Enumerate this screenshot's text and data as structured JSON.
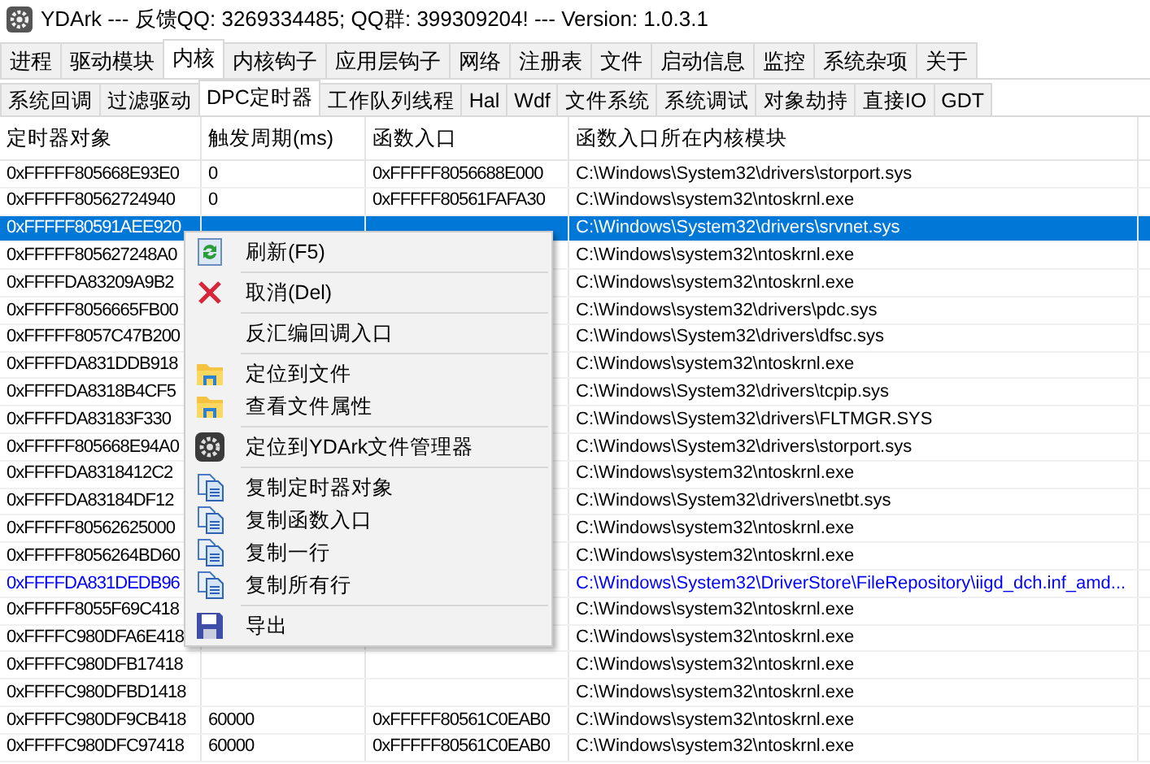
{
  "window": {
    "title": "YDArk --- 反馈QQ: 3269334485; QQ群: 399309204! --- Version: 1.0.3.1"
  },
  "tabs": [
    {
      "label": "进程",
      "selected": false
    },
    {
      "label": "驱动模块",
      "selected": false
    },
    {
      "label": "内核",
      "selected": true
    },
    {
      "label": "内核钩子",
      "selected": false
    },
    {
      "label": "应用层钩子",
      "selected": false
    },
    {
      "label": "网络",
      "selected": false
    },
    {
      "label": "注册表",
      "selected": false
    },
    {
      "label": "文件",
      "selected": false
    },
    {
      "label": "启动信息",
      "selected": false
    },
    {
      "label": "监控",
      "selected": false
    },
    {
      "label": "系统杂项",
      "selected": false
    },
    {
      "label": "关于",
      "selected": false
    }
  ],
  "subtabs": [
    {
      "label": "系统回调",
      "selected": false
    },
    {
      "label": "过滤驱动",
      "selected": false
    },
    {
      "label": "DPC定时器",
      "selected": true
    },
    {
      "label": "工作队列线程",
      "selected": false
    },
    {
      "label": "Hal",
      "selected": false
    },
    {
      "label": "Wdf",
      "selected": false
    },
    {
      "label": "文件系统",
      "selected": false
    },
    {
      "label": "系统调试",
      "selected": false
    },
    {
      "label": "对象劫持",
      "selected": false
    },
    {
      "label": "直接IO",
      "selected": false
    },
    {
      "label": "GDT",
      "selected": false
    }
  ],
  "table": {
    "columns": [
      "定时器对象",
      "触发周期(ms)",
      "函数入口",
      "函数入口所在内核模块"
    ],
    "rows": [
      {
        "timer_object": "0xFFFFF805668E93E0",
        "period": "0",
        "entry": "0xFFFFF8056688E000",
        "module": "C:\\Windows\\System32\\drivers\\storport.sys",
        "selected": false,
        "color": "#000000"
      },
      {
        "timer_object": "0xFFFFF80562724940",
        "period": "0",
        "entry": "0xFFFFF80561FAFA30",
        "module": "C:\\Windows\\system32\\ntoskrnl.exe",
        "selected": false,
        "color": "#000000"
      },
      {
        "timer_object": "0xFFFFF80591AEE920",
        "module": "C:\\Windows\\System32\\drivers\\srvnet.sys",
        "selected": true
      },
      {
        "timer_object": "0xFFFFF805627248A0",
        "module": "C:\\Windows\\system32\\ntoskrnl.exe",
        "selected": false,
        "color": "#000000"
      },
      {
        "timer_object": "0xFFFFDA83209A9B2",
        "module": "C:\\Windows\\system32\\ntoskrnl.exe",
        "selected": false,
        "color": "#000000"
      },
      {
        "timer_object": "0xFFFFF8056665FB00",
        "module": "C:\\Windows\\system32\\drivers\\pdc.sys",
        "selected": false,
        "color": "#000000"
      },
      {
        "timer_object": "0xFFFFF8057C47B200",
        "module": "C:\\Windows\\System32\\drivers\\dfsc.sys",
        "selected": false,
        "color": "#000000"
      },
      {
        "timer_object": "0xFFFFDA831DDB918",
        "module": "C:\\Windows\\system32\\ntoskrnl.exe",
        "selected": false,
        "color": "#000000"
      },
      {
        "timer_object": "0xFFFFDA8318B4CF5",
        "module": "C:\\Windows\\System32\\drivers\\tcpip.sys",
        "selected": false,
        "color": "#000000"
      },
      {
        "timer_object": "0xFFFFDA83183F330",
        "module": "C:\\Windows\\System32\\drivers\\FLTMGR.SYS",
        "selected": false,
        "color": "#000000"
      },
      {
        "timer_object": "0xFFFFF805668E94A0",
        "module": "C:\\Windows\\System32\\drivers\\storport.sys",
        "selected": false,
        "color": "#000000"
      },
      {
        "timer_object": "0xFFFFDA8318412C2",
        "module": "C:\\Windows\\system32\\ntoskrnl.exe",
        "selected": false,
        "color": "#000000"
      },
      {
        "timer_object": "0xFFFFDA83184DF12",
        "module": "C:\\Windows\\System32\\drivers\\netbt.sys",
        "selected": false,
        "color": "#000000"
      },
      {
        "timer_object": "0xFFFFF80562625000",
        "module": "C:\\Windows\\system32\\ntoskrnl.exe",
        "selected": false,
        "color": "#000000"
      },
      {
        "timer_object": "0xFFFFF8056264BD60",
        "module": "C:\\Windows\\system32\\ntoskrnl.exe",
        "selected": false,
        "color": "#000000"
      },
      {
        "timer_object": "0xFFFFDA831DEDB96",
        "module": "C:\\Windows\\System32\\DriverStore\\FileRepository\\iigd_dch.inf_amd...",
        "selected": false,
        "color": "#0000ff"
      },
      {
        "timer_object": "0xFFFFF8055F69C418",
        "module": "C:\\Windows\\system32\\ntoskrnl.exe",
        "selected": false,
        "color": "#000000"
      },
      {
        "timer_object": "0xFFFFC980DFA6E418",
        "module": "C:\\Windows\\system32\\ntoskrnl.exe",
        "selected": false,
        "color": "#000000"
      },
      {
        "timer_object": "0xFFFFC980DFB17418",
        "module": "C:\\Windows\\system32\\ntoskrnl.exe",
        "selected": false,
        "color": "#000000"
      },
      {
        "timer_object": "0xFFFFC980DFBD1418",
        "module": "C:\\Windows\\system32\\ntoskrnl.exe",
        "selected": false,
        "color": "#000000"
      },
      {
        "timer_object": "0xFFFFC980DF9CB418",
        "period": "60000",
        "entry": "0xFFFFF80561C0EAB0",
        "module": "C:\\Windows\\system32\\ntoskrnl.exe",
        "selected": false,
        "color": "#000000"
      },
      {
        "timer_object": "0xFFFFC980DFC97418",
        "period": "60000",
        "entry": "0xFFFFF80561C0EAB0",
        "module": "C:\\Windows\\system32\\ntoskrnl.exe",
        "selected": false,
        "color": "#000000"
      }
    ]
  },
  "context_menu": {
    "groups": [
      [
        {
          "label": "刷新(F5)",
          "kind": "refresh"
        }
      ],
      [
        {
          "label": "取消(Del)",
          "kind": "cancel"
        }
      ],
      [
        {
          "label": "反汇编回调入口",
          "kind": "none"
        }
      ],
      [
        {
          "label": "定位到文件",
          "kind": "folder"
        },
        {
          "label": "查看文件属性",
          "kind": "folder"
        }
      ],
      [
        {
          "label": "定位到YDArk文件管理器",
          "kind": "gear"
        }
      ],
      [
        {
          "label": "复制定时器对象",
          "kind": "copy"
        },
        {
          "label": "复制函数入口",
          "kind": "copy"
        },
        {
          "label": "复制一行",
          "kind": "copy"
        },
        {
          "label": "复制所有行",
          "kind": "copy"
        }
      ],
      [
        {
          "label": "导出",
          "kind": "save"
        }
      ]
    ]
  }
}
